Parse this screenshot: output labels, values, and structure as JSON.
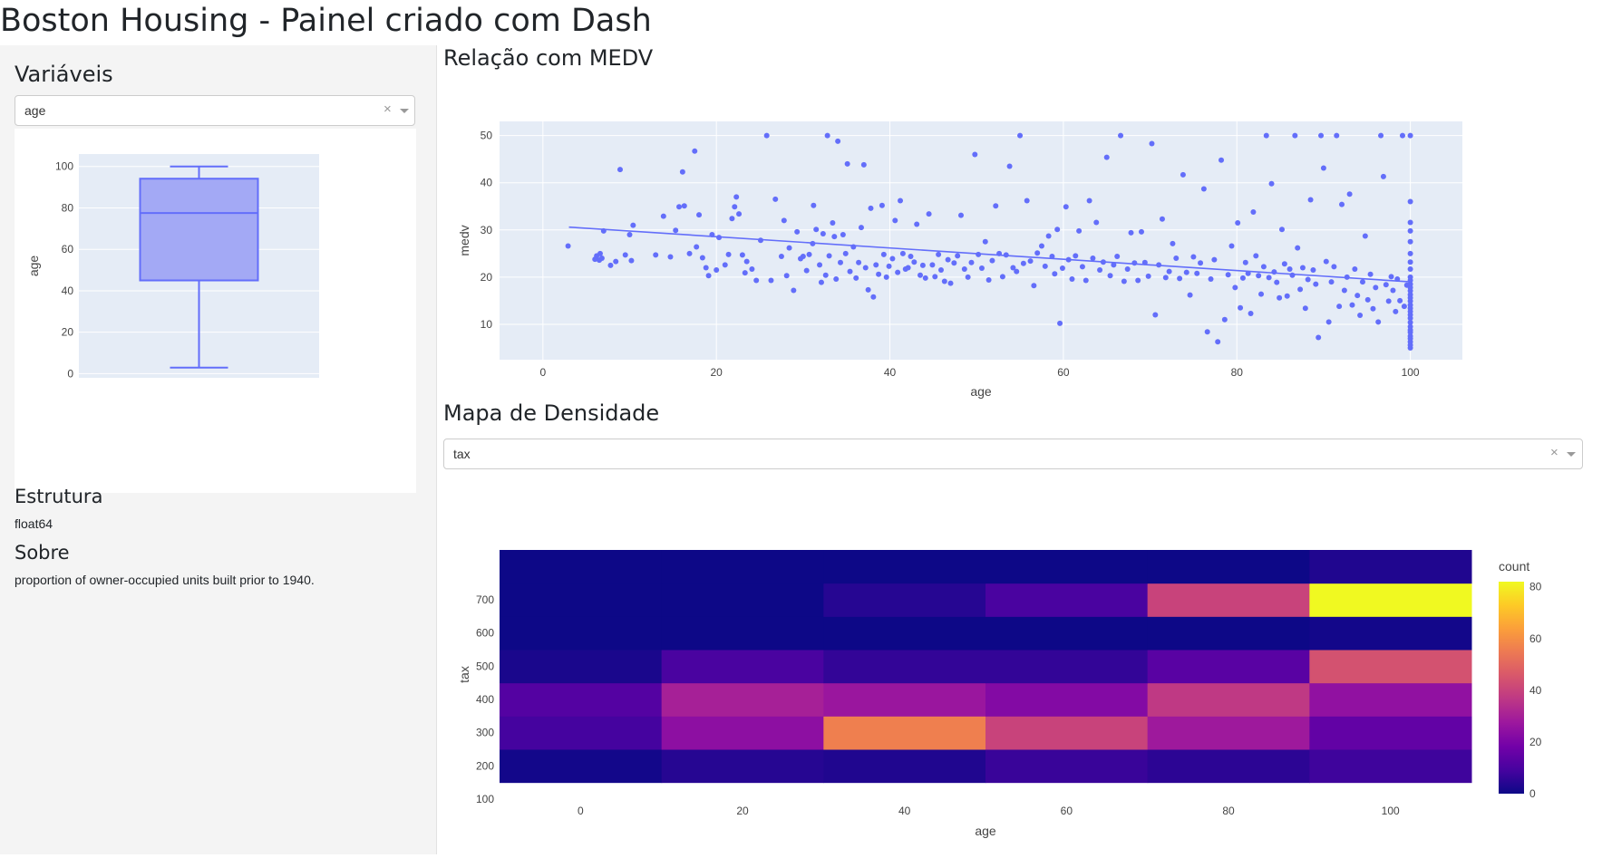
{
  "page": {
    "title": "Boston Housing - Painel criado com Dash"
  },
  "sidebar": {
    "variables_heading": "Variáveis",
    "variable_dropdown": {
      "value": "age",
      "clear_icon": "×"
    },
    "structure_heading": "Estrutura",
    "structure_value": "float64",
    "about_heading": "Sobre",
    "about_text": "proportion of owner-occupied units built prior to 1940."
  },
  "modebar": {
    "icons": [
      "camera-icon",
      "zoom-icon",
      "pan-icon",
      "zoom-in-icon",
      "zoom-out-icon",
      "autoscale-icon",
      "reset-axes-icon",
      "plotly-logo-icon"
    ]
  },
  "main": {
    "scatter_heading": "Relação com MEDV",
    "density_heading": "Mapa de Densidade",
    "density_dropdown": {
      "value": "tax",
      "clear_icon": "×"
    }
  },
  "colors": {
    "plot_bg": "#e5ecf6",
    "marker": "#636efa",
    "box_fill": "#a3a9f5",
    "plasma": [
      "#0d0887",
      "#46039f",
      "#7201a8",
      "#9c179e",
      "#bd3786",
      "#d8576b",
      "#ed7953",
      "#fb9f3a",
      "#fdca26",
      "#f0f921"
    ]
  },
  "box_chart": {
    "type": "box",
    "ylabel": "age",
    "ylim": [
      -2,
      106
    ],
    "yticks": [
      0,
      20,
      40,
      60,
      80,
      100
    ],
    "min": 2.9,
    "q1": 45.0,
    "median": 77.5,
    "q3": 94.1,
    "max": 100
  },
  "chart_data": [
    {
      "type": "scatter",
      "xlabel": "age",
      "ylabel": "medv",
      "xlim": [
        -5,
        106
      ],
      "ylim": [
        2.5,
        53
      ],
      "xticks": [
        0,
        20,
        40,
        60,
        80,
        100
      ],
      "yticks": [
        10,
        20,
        30,
        40,
        50
      ],
      "trendline": {
        "x": [
          3,
          100
        ],
        "y": [
          30.6,
          19.0
        ]
      },
      "points": [
        [
          2.9,
          26.6
        ],
        [
          6.0,
          23.8
        ],
        [
          6.2,
          24.5
        ],
        [
          6.5,
          23.6
        ],
        [
          6.6,
          25.0
        ],
        [
          6.8,
          24.0
        ],
        [
          7.0,
          29.8
        ],
        [
          7.8,
          22.5
        ],
        [
          8.4,
          23.3
        ],
        [
          8.9,
          42.8
        ],
        [
          9.5,
          24.7
        ],
        [
          10.0,
          29.0
        ],
        [
          10.2,
          23.5
        ],
        [
          10.4,
          31.0
        ],
        [
          13.0,
          24.7
        ],
        [
          13.9,
          32.9
        ],
        [
          14.7,
          24.3
        ],
        [
          15.3,
          29.9
        ],
        [
          15.7,
          34.9
        ],
        [
          16.1,
          42.3
        ],
        [
          16.3,
          35.1
        ],
        [
          16.9,
          25.0
        ],
        [
          17.5,
          46.7
        ],
        [
          17.7,
          26.4
        ],
        [
          18.0,
          33.2
        ],
        [
          18.4,
          24.1
        ],
        [
          18.8,
          22.0
        ],
        [
          19.1,
          20.3
        ],
        [
          19.5,
          29.0
        ],
        [
          20.0,
          21.5
        ],
        [
          20.3,
          28.4
        ],
        [
          21.0,
          22.6
        ],
        [
          21.4,
          24.8
        ],
        [
          21.8,
          32.4
        ],
        [
          22.1,
          34.9
        ],
        [
          22.3,
          37.0
        ],
        [
          22.6,
          33.4
        ],
        [
          23.0,
          24.7
        ],
        [
          23.3,
          20.9
        ],
        [
          23.5,
          23.3
        ],
        [
          24.1,
          21.7
        ],
        [
          24.6,
          19.3
        ],
        [
          25.1,
          27.8
        ],
        [
          25.8,
          50.0
        ],
        [
          26.3,
          19.3
        ],
        [
          26.8,
          36.5
        ],
        [
          27.5,
          24.4
        ],
        [
          27.8,
          32.0
        ],
        [
          28.1,
          20.3
        ],
        [
          28.4,
          26.2
        ],
        [
          28.9,
          17.2
        ],
        [
          29.3,
          29.6
        ],
        [
          29.7,
          23.9
        ],
        [
          30.0,
          24.4
        ],
        [
          30.4,
          21.4
        ],
        [
          30.7,
          24.8
        ],
        [
          31.1,
          27.1
        ],
        [
          31.2,
          35.2
        ],
        [
          31.5,
          30.1
        ],
        [
          31.9,
          22.6
        ],
        [
          32.1,
          18.9
        ],
        [
          32.3,
          29.2
        ],
        [
          32.6,
          20.4
        ],
        [
          32.8,
          50.0
        ],
        [
          33.0,
          24.5
        ],
        [
          33.4,
          31.5
        ],
        [
          33.6,
          28.6
        ],
        [
          33.8,
          19.6
        ],
        [
          34.0,
          48.8
        ],
        [
          34.3,
          23.1
        ],
        [
          34.6,
          29.0
        ],
        [
          34.9,
          25.0
        ],
        [
          35.1,
          44.0
        ],
        [
          35.4,
          21.2
        ],
        [
          35.8,
          26.4
        ],
        [
          36.1,
          19.8
        ],
        [
          36.4,
          23.1
        ],
        [
          36.7,
          30.5
        ],
        [
          37.0,
          43.8
        ],
        [
          37.2,
          22.0
        ],
        [
          37.5,
          17.3
        ],
        [
          37.8,
          34.6
        ],
        [
          38.1,
          15.8
        ],
        [
          38.4,
          22.6
        ],
        [
          38.7,
          20.6
        ],
        [
          39.1,
          35.2
        ],
        [
          39.3,
          24.8
        ],
        [
          39.6,
          20.0
        ],
        [
          39.9,
          22.3
        ],
        [
          40.3,
          23.9
        ],
        [
          40.6,
          32.0
        ],
        [
          40.9,
          21.0
        ],
        [
          41.2,
          36.2
        ],
        [
          41.5,
          25.0
        ],
        [
          41.8,
          21.7
        ],
        [
          42.1,
          22.0
        ],
        [
          42.4,
          24.4
        ],
        [
          42.8,
          23.2
        ],
        [
          43.1,
          31.2
        ],
        [
          43.5,
          20.4
        ],
        [
          43.8,
          22.5
        ],
        [
          44.1,
          19.8
        ],
        [
          44.5,
          33.4
        ],
        [
          44.9,
          22.6
        ],
        [
          45.2,
          20.1
        ],
        [
          45.6,
          24.8
        ],
        [
          45.9,
          21.5
        ],
        [
          46.3,
          19.1
        ],
        [
          46.7,
          23.7
        ],
        [
          47.0,
          18.7
        ],
        [
          47.4,
          23.0
        ],
        [
          47.8,
          24.5
        ],
        [
          48.2,
          33.1
        ],
        [
          48.6,
          21.7
        ],
        [
          49.0,
          20.0
        ],
        [
          49.4,
          23.1
        ],
        [
          49.8,
          46.0
        ],
        [
          50.2,
          24.8
        ],
        [
          50.6,
          21.9
        ],
        [
          51.0,
          27.5
        ],
        [
          51.4,
          19.4
        ],
        [
          51.8,
          23.5
        ],
        [
          52.2,
          35.1
        ],
        [
          52.6,
          25.0
        ],
        [
          53.0,
          20.1
        ],
        [
          53.4,
          24.7
        ],
        [
          53.8,
          43.5
        ],
        [
          54.2,
          22.0
        ],
        [
          54.6,
          21.2
        ],
        [
          55.0,
          50.0
        ],
        [
          55.4,
          22.9
        ],
        [
          55.8,
          36.2
        ],
        [
          56.2,
          23.4
        ],
        [
          56.6,
          18.2
        ],
        [
          57.0,
          25.1
        ],
        [
          57.5,
          26.6
        ],
        [
          57.9,
          22.3
        ],
        [
          58.3,
          28.7
        ],
        [
          58.7,
          24.4
        ],
        [
          59.0,
          20.7
        ],
        [
          59.3,
          30.1
        ],
        [
          59.6,
          10.2
        ],
        [
          59.9,
          21.9
        ],
        [
          60.3,
          34.9
        ],
        [
          60.6,
          23.7
        ],
        [
          61.0,
          19.6
        ],
        [
          61.4,
          24.5
        ],
        [
          61.8,
          29.8
        ],
        [
          62.2,
          22.2
        ],
        [
          62.6,
          19.3
        ],
        [
          63.0,
          36.2
        ],
        [
          63.4,
          24.0
        ],
        [
          63.8,
          31.6
        ],
        [
          64.2,
          21.5
        ],
        [
          64.6,
          23.2
        ],
        [
          65.0,
          45.4
        ],
        [
          65.4,
          20.3
        ],
        [
          65.8,
          22.6
        ],
        [
          66.2,
          24.4
        ],
        [
          66.6,
          50.0
        ],
        [
          67.0,
          19.1
        ],
        [
          67.4,
          21.7
        ],
        [
          67.8,
          29.4
        ],
        [
          68.2,
          23.0
        ],
        [
          68.6,
          19.3
        ],
        [
          69.0,
          29.6
        ],
        [
          69.4,
          23.1
        ],
        [
          69.8,
          20.2
        ],
        [
          70.2,
          48.3
        ],
        [
          70.6,
          12.0
        ],
        [
          71.0,
          22.6
        ],
        [
          71.4,
          32.3
        ],
        [
          71.8,
          19.9
        ],
        [
          72.2,
          21.2
        ],
        [
          72.6,
          27.1
        ],
        [
          73.0,
          24.0
        ],
        [
          73.4,
          19.7
        ],
        [
          73.8,
          41.7
        ],
        [
          74.2,
          21.0
        ],
        [
          74.6,
          16.2
        ],
        [
          75.0,
          24.3
        ],
        [
          75.4,
          20.8
        ],
        [
          75.8,
          23.0
        ],
        [
          76.2,
          38.7
        ],
        [
          76.6,
          8.4
        ],
        [
          77.0,
          19.6
        ],
        [
          77.4,
          23.7
        ],
        [
          77.8,
          6.3
        ],
        [
          78.2,
          44.8
        ],
        [
          78.6,
          11.0
        ],
        [
          79.0,
          20.5
        ],
        [
          79.4,
          26.6
        ],
        [
          79.8,
          17.8
        ],
        [
          80.1,
          31.5
        ],
        [
          80.4,
          13.5
        ],
        [
          80.7,
          19.8
        ],
        [
          81.0,
          23.1
        ],
        [
          81.3,
          20.8
        ],
        [
          81.6,
          12.3
        ],
        [
          81.9,
          33.8
        ],
        [
          82.2,
          24.5
        ],
        [
          82.5,
          20.3
        ],
        [
          82.8,
          16.4
        ],
        [
          83.1,
          22.2
        ],
        [
          83.4,
          50.0
        ],
        [
          83.7,
          19.9
        ],
        [
          84.0,
          39.8
        ],
        [
          84.3,
          21.1
        ],
        [
          84.6,
          18.9
        ],
        [
          84.9,
          15.6
        ],
        [
          85.2,
          30.1
        ],
        [
          85.5,
          22.8
        ],
        [
          85.8,
          16.0
        ],
        [
          86.1,
          21.7
        ],
        [
          86.4,
          20.4
        ],
        [
          86.7,
          50.0
        ],
        [
          87.0,
          26.2
        ],
        [
          87.3,
          17.4
        ],
        [
          87.6,
          22.0
        ],
        [
          87.9,
          13.4
        ],
        [
          88.2,
          19.5
        ],
        [
          88.5,
          36.4
        ],
        [
          88.8,
          21.5
        ],
        [
          89.1,
          18.5
        ],
        [
          89.4,
          7.2
        ],
        [
          89.7,
          50.0
        ],
        [
          90.0,
          43.1
        ],
        [
          90.3,
          23.3
        ],
        [
          90.6,
          10.5
        ],
        [
          90.9,
          19.0
        ],
        [
          91.2,
          22.2
        ],
        [
          91.5,
          50.0
        ],
        [
          91.8,
          13.8
        ],
        [
          92.1,
          35.4
        ],
        [
          92.4,
          17.2
        ],
        [
          92.7,
          20.0
        ],
        [
          93.0,
          37.6
        ],
        [
          93.3,
          14.1
        ],
        [
          93.6,
          21.7
        ],
        [
          93.9,
          16.1
        ],
        [
          94.2,
          11.9
        ],
        [
          94.5,
          19.0
        ],
        [
          94.8,
          28.7
        ],
        [
          95.1,
          15.2
        ],
        [
          95.4,
          20.6
        ],
        [
          95.7,
          13.3
        ],
        [
          96.0,
          17.8
        ],
        [
          96.3,
          10.5
        ],
        [
          96.6,
          50.0
        ],
        [
          96.9,
          41.3
        ],
        [
          97.2,
          18.4
        ],
        [
          97.5,
          14.9
        ],
        [
          97.8,
          20.1
        ],
        [
          98.0,
          17.2
        ],
        [
          98.3,
          12.7
        ],
        [
          98.5,
          19.6
        ],
        [
          98.8,
          15.0
        ],
        [
          99.1,
          50.0
        ],
        [
          99.3,
          13.8
        ],
        [
          99.6,
          18.3
        ],
        [
          100,
          5.0
        ],
        [
          100,
          5.6
        ],
        [
          100,
          6.3
        ],
        [
          100,
          7.0
        ],
        [
          100,
          7.5
        ],
        [
          100,
          8.3
        ],
        [
          100,
          8.8
        ],
        [
          100,
          9.5
        ],
        [
          100,
          10.4
        ],
        [
          100,
          11.3
        ],
        [
          100,
          12.0
        ],
        [
          100,
          12.7
        ],
        [
          100,
          13.4
        ],
        [
          100,
          14.1
        ],
        [
          100,
          14.9
        ],
        [
          100,
          15.6
        ],
        [
          100,
          16.3
        ],
        [
          100,
          17.1
        ],
        [
          100,
          17.8
        ],
        [
          100,
          18.5
        ],
        [
          100,
          19.3
        ],
        [
          100,
          20.0
        ],
        [
          100,
          21.7
        ],
        [
          100,
          23.2
        ],
        [
          100,
          25.0
        ],
        [
          100,
          27.5
        ],
        [
          100,
          29.8
        ],
        [
          100,
          31.6
        ],
        [
          100,
          36.0
        ],
        [
          100,
          50.0
        ]
      ]
    },
    {
      "type": "heatmap",
      "xlabel": "age",
      "ylabel": "tax",
      "colorbar_title": "count",
      "x_bins": [
        [
          -10,
          10
        ],
        [
          10,
          30
        ],
        [
          30,
          50
        ],
        [
          50,
          70
        ],
        [
          70,
          90
        ],
        [
          90,
          110
        ]
      ],
      "y_bins": [
        [
          150,
          250
        ],
        [
          250,
          350
        ],
        [
          350,
          450
        ],
        [
          450,
          550
        ],
        [
          550,
          650
        ],
        [
          650,
          750
        ],
        [
          750,
          850
        ]
      ],
      "xticks": [
        0,
        20,
        40,
        60,
        80,
        100
      ],
      "yticks": [
        100,
        200,
        300,
        400,
        500,
        600,
        700
      ],
      "zmin": 0,
      "zmax": 82,
      "counts": [
        [
          1,
          4,
          3,
          7,
          5,
          8
        ],
        [
          9,
          24,
          56,
          40,
          28,
          15
        ],
        [
          12,
          30,
          27,
          22,
          37,
          25
        ],
        [
          2,
          10,
          6,
          6,
          13,
          44
        ],
        [
          0,
          0,
          0,
          0,
          0,
          1
        ],
        [
          0,
          0,
          4,
          10,
          40,
          82
        ],
        [
          0,
          0,
          0,
          0,
          0,
          3
        ]
      ],
      "colorbar_ticks": [
        0,
        20,
        40,
        60,
        80
      ]
    }
  ]
}
